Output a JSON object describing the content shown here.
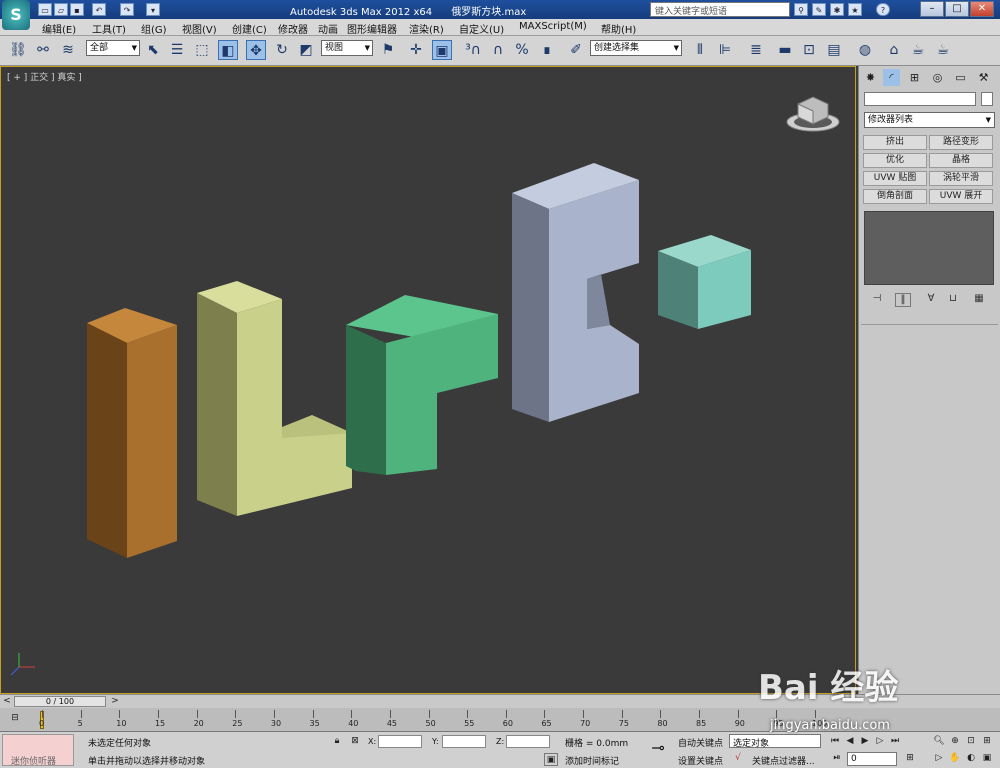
{
  "window": {
    "app_title": "Autodesk 3ds Max  2012 x64",
    "file_name": "俄罗斯方块.max",
    "search_placeholder": "键入关键字或短语",
    "min": "–",
    "max": "□",
    "close": "✕"
  },
  "menu": [
    "编辑(E)",
    "工具(T)",
    "组(G)",
    "视图(V)",
    "创建(C)",
    "修改器",
    "动画",
    "图形编辑器",
    "渲染(R)",
    "自定义(U)",
    "MAXScript(M)",
    "帮助(H)"
  ],
  "toolbar": {
    "selection_filter": "全部",
    "ref_coord": "视图",
    "named_selection": "创建选择集"
  },
  "viewport": {
    "label": "[ + ] 正交 ] 真实 ]",
    "background_color": "#3a3a3a"
  },
  "command_panel": {
    "modifier_list": "修改器列表",
    "modifier_buttons": [
      "挤出",
      "路径变形",
      "优化",
      "晶格",
      "UVW 贴图",
      "涡轮平滑",
      "倒角剖面",
      "UVW 展开"
    ]
  },
  "timeline": {
    "frame": "0 / 100",
    "ticks": [
      "0",
      "5",
      "10",
      "15",
      "20",
      "25",
      "30",
      "35",
      "40",
      "45",
      "50",
      "55",
      "60",
      "65",
      "70",
      "75",
      "80",
      "85",
      "90",
      "95",
      "100"
    ]
  },
  "status": {
    "script_input": "迷你侦听器",
    "selection_status": "未选定任何对象",
    "prompt": "单击并拖动以选择并移动对象",
    "x_label": "X:",
    "y_label": "Y:",
    "z_label": "Z:",
    "grid": "栅格 = 0.0mm",
    "add_time_tag": "添加时间标记",
    "auto_key": "自动关键点",
    "set_key": "设置关键点",
    "selected_dropdown": "选定对象",
    "key_filters": "关键点过滤器...",
    "frame_field": "0"
  },
  "watermark": {
    "text": "Bai 经验",
    "url": "jingyan.baidu.com"
  },
  "colors": {
    "orange_block": "#a8702c",
    "yellow_block": "#c8d08a",
    "green_block": "#4fb37e",
    "gray_block": "#a9b4cc",
    "teal_block": "#7dcbbd",
    "viewport_border": "#c8a020"
  }
}
